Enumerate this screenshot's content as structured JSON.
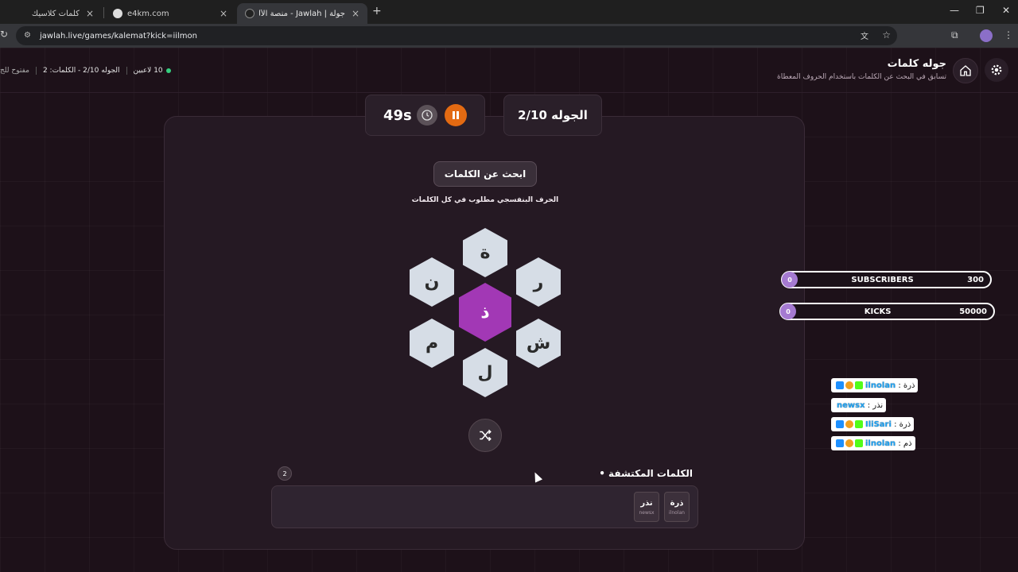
{
  "browser": {
    "tabs": [
      {
        "title": "كلمات كلاسيك",
        "active": false
      },
      {
        "title": "e4km.com",
        "active": false
      },
      {
        "title": "جولة | Jawlah - منصة الألعاب الت",
        "active": true
      }
    ],
    "url": "jawlah.live/games/kalemat?kick=iilmon"
  },
  "header": {
    "title": "جوله كلمات",
    "subtitle": "تسابق في البحث عن الكلمات باستخدام الحروف المعطاة",
    "players": "10 لاعبين",
    "round_words": "الجوله 2/10 - الكلمات: 2",
    "open_text": "مفتوح للج"
  },
  "game": {
    "round_label": "الجوله 2/10",
    "timer": "49s",
    "search_label": "ابحث عن الكلمات",
    "hint": "الحرف البنفسجي مطلوب في كل الكلمات",
    "letters": {
      "top": "ة",
      "upper_left": "ن",
      "upper_right": "ر",
      "center": "ذ",
      "lower_left": "م",
      "lower_right": "ش",
      "bottom": "ل"
    },
    "center_color": "#a238b5",
    "found_title": "الكلمات المكتشفة",
    "found_count": "2",
    "found_words": [
      {
        "word": "ذرة",
        "user": "ilnolan"
      },
      {
        "word": "نذر",
        "user": "newsx"
      }
    ]
  },
  "goals": [
    {
      "start": "0",
      "label": "SUBSCRIBERS",
      "target": "300"
    },
    {
      "start": "0",
      "label": "KICKS",
      "target": "50000"
    }
  ],
  "chat": [
    {
      "user": "ilnolan",
      "text": "ذرة"
    },
    {
      "user": "newsx",
      "text": "نذر"
    },
    {
      "user": "IliSari",
      "text": "ذرة"
    },
    {
      "user": "ilnolan",
      "text": "ذم"
    }
  ]
}
